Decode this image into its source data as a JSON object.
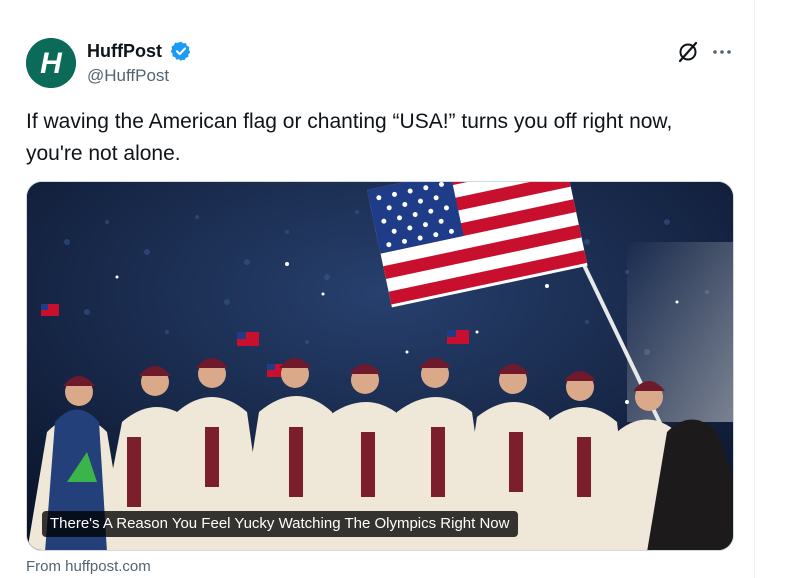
{
  "author": {
    "name": "HuffPost",
    "handle": "@HuffPost",
    "avatar_letter": "H",
    "avatar_color": "#0c6b58",
    "verified_color": "#1d9bf0"
  },
  "tweet": {
    "text": "If waving the American flag or chanting “USA!” turns you off right now, you're not alone."
  },
  "card": {
    "title": "There's A Reason You Feel Yucky Watching The Olympics Right Now",
    "source": "From huffpost.com"
  },
  "icons": {
    "grok": "grok-icon",
    "more": "more-icon",
    "verified": "verified-badge-icon"
  }
}
